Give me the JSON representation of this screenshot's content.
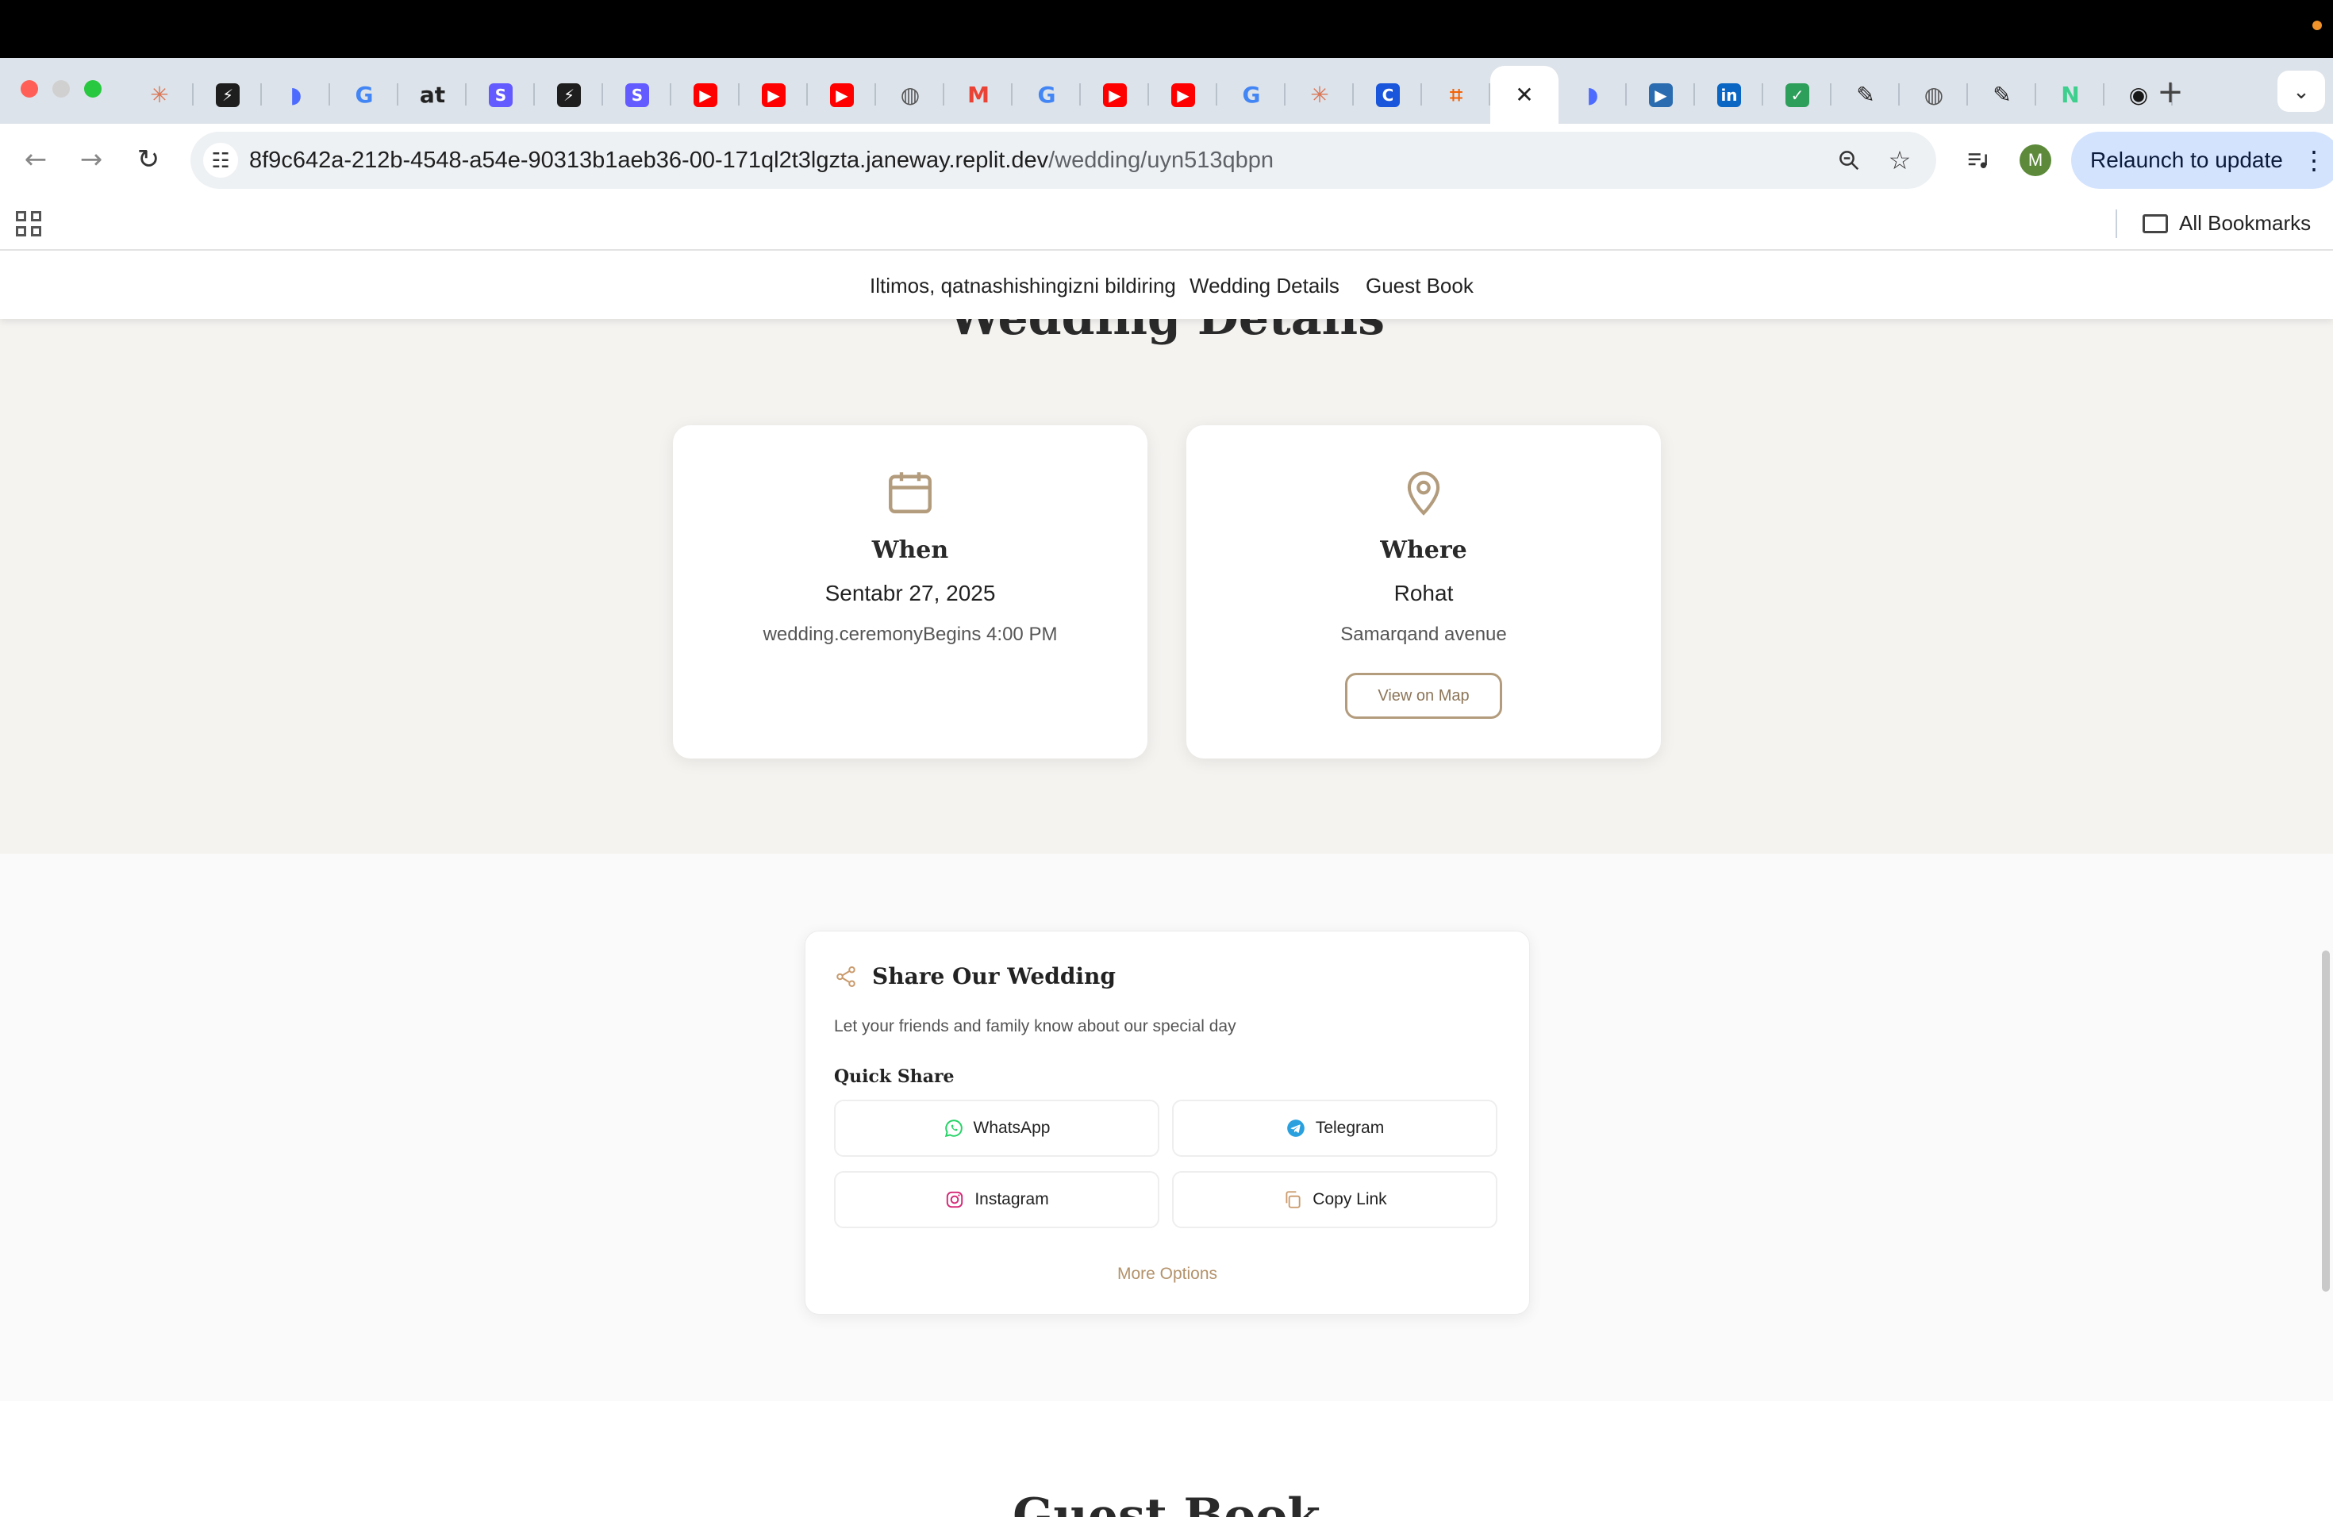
{
  "browser": {
    "url_host": "8f9c642a-212b-4548-a54e-90313b1aeb36-00-171ql2t3lgzta.janeway.replit.dev",
    "url_path": "/wedding/uyn513qbpn",
    "relaunch_label": "Relaunch to update",
    "profile_initial": "M",
    "all_bookmarks_label": "All Bookmarks",
    "tabs": [
      {
        "icon": "claude-icon",
        "color": "#d97757"
      },
      {
        "icon": "bolt-icon",
        "color": "#1e1e1e"
      },
      {
        "icon": "deepseek-icon",
        "color": "#4d6bfe"
      },
      {
        "icon": "google-icon",
        "color": "#4285f4"
      },
      {
        "icon": "at-icon",
        "color": "#222222"
      },
      {
        "icon": "s-app-icon",
        "color": "#635bff"
      },
      {
        "icon": "bolt-icon",
        "color": "#1e1e1e"
      },
      {
        "icon": "s-app-icon",
        "color": "#635bff"
      },
      {
        "icon": "youtube-icon",
        "color": "#ff0000"
      },
      {
        "icon": "youtube-icon",
        "color": "#ff0000"
      },
      {
        "icon": "youtube-icon",
        "color": "#ff0000"
      },
      {
        "icon": "globe-icon",
        "color": "#555555"
      },
      {
        "icon": "gmail-icon",
        "color": "#ea4335"
      },
      {
        "icon": "google-icon",
        "color": "#4285f4"
      },
      {
        "icon": "youtube-icon",
        "color": "#ff0000"
      },
      {
        "icon": "youtube-icon",
        "color": "#ff0000"
      },
      {
        "icon": "google-icon",
        "color": "#4285f4"
      },
      {
        "icon": "claude-icon",
        "color": "#d97757"
      },
      {
        "icon": "c-app-icon",
        "color": "#1a56db"
      },
      {
        "icon": "replit-icon",
        "color": "#f26207"
      },
      {
        "icon": "close-icon",
        "color": "#222222"
      },
      {
        "icon": "deepseek-icon",
        "color": "#4d6bfe"
      },
      {
        "icon": "video-icon",
        "color": "#2b6cb0"
      },
      {
        "icon": "linkedin-icon",
        "color": "#0a66c2"
      },
      {
        "icon": "checklist-icon",
        "color": "#2e9e5b"
      },
      {
        "icon": "ext-icon",
        "color": "#222222"
      },
      {
        "icon": "globe-icon",
        "color": "#555555"
      },
      {
        "icon": "ext-icon",
        "color": "#222222"
      },
      {
        "icon": "notepad-icon",
        "color": "#3ecf8e"
      },
      {
        "icon": "github-icon",
        "color": "#181717"
      }
    ]
  },
  "site": {
    "nav": [
      "Iltimos, qatnashishingizni bildiring",
      "Wedding Details",
      "Guest Book"
    ],
    "details_title": "Wedding Details",
    "when": {
      "heading": "When",
      "date": "Sentabr 27, 2025",
      "time": "wedding.ceremonyBegins 4:00 PM"
    },
    "where": {
      "heading": "Where",
      "venue": "Rohat",
      "address": "Samarqand avenue",
      "map_button": "View on Map"
    },
    "share": {
      "title": "Share Our Wedding",
      "subtitle": "Let your friends and family know about our special day",
      "quick_share": "Quick Share",
      "buttons": [
        "WhatsApp",
        "Telegram",
        "Instagram",
        "Copy Link"
      ],
      "more_options": "More Options"
    },
    "guestbook_title": "Guest Book",
    "accent_color": "#b39c7d"
  }
}
